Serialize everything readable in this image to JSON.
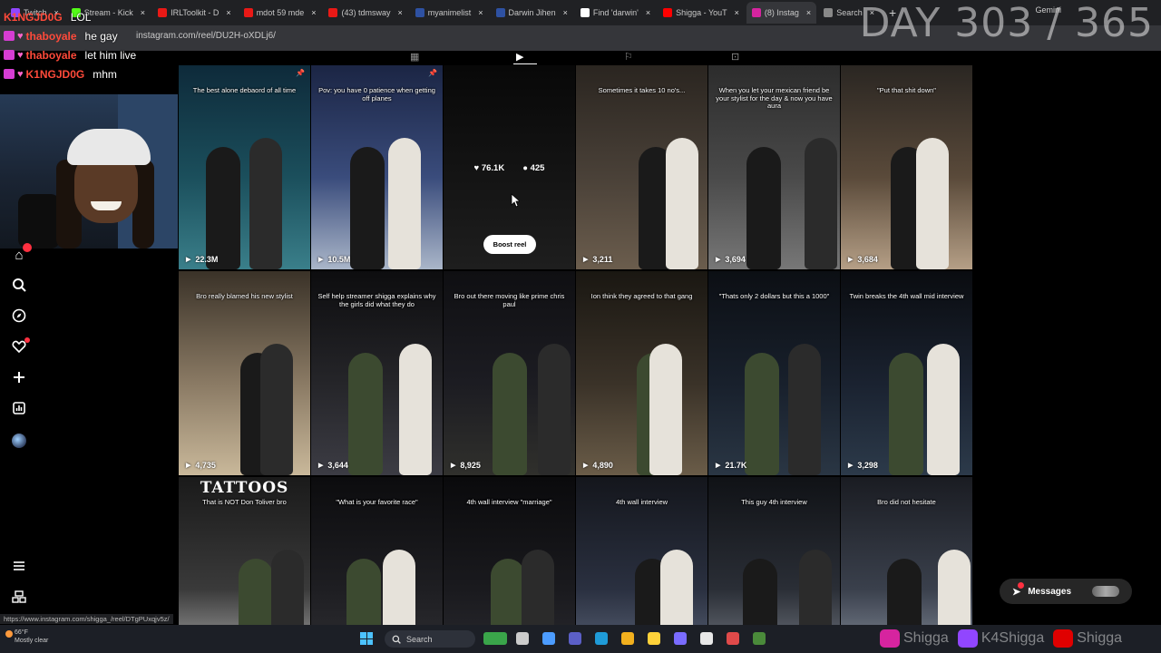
{
  "browser": {
    "tabs": [
      {
        "label": "Twitch",
        "color": "#9146ff"
      },
      {
        "label": "Stream - Kick",
        "color": "#53fc18"
      },
      {
        "label": "IRLToolkit - D",
        "color": "#e91916"
      },
      {
        "label": "mdot 59 mde",
        "color": "#e91916"
      },
      {
        "label": "(43) tdmsway",
        "color": "#e91916"
      },
      {
        "label": "myanimelist",
        "color": "#2e51a2"
      },
      {
        "label": "Darwin Jihen",
        "color": "#2e51a2"
      },
      {
        "label": "Find 'darwin'",
        "color": "#ffffff"
      },
      {
        "label": "Shigga - YouT",
        "color": "#ff0000"
      },
      {
        "label": "(8) Instag",
        "color": "#d6249f"
      },
      {
        "label": "Search",
        "color": "#888888"
      }
    ],
    "gemini_label": "Gemini",
    "url": "instagram.com/reel/DU2H-oXDLj6/",
    "day_counter": "DAY 303 / 365",
    "status_url": "https://www.instagram.com/shigga_/reel/DTgPUxqjv5z/"
  },
  "chat": [
    {
      "user": "K1NGJD0G",
      "message": "LOL",
      "color": "#ff4a3a"
    },
    {
      "user": "thaboyale",
      "message": "he gay",
      "color": "#ff4a3a"
    },
    {
      "user": "thaboyale",
      "message": "let him live",
      "color": "#ff4a3a"
    },
    {
      "user": "K1NGJD0G",
      "message": "mhm",
      "color": "#ff4a3a"
    }
  ],
  "hover_reel": {
    "likes": "76.1K",
    "comments": "425",
    "boost_label": "Boost reel"
  },
  "reels": [
    {
      "caption": "The best alone debaord of all time",
      "views": "22.3M"
    },
    {
      "caption": "Pov: you have 0 patience when getting off planes",
      "views": "10.5M"
    },
    {
      "caption": "",
      "views": ""
    },
    {
      "caption": "Sometimes it takes 10 no's...",
      "views": "3,211"
    },
    {
      "caption": "When you let your mexican friend be your stylist for the day & now you have aura",
      "views": "3,694"
    },
    {
      "caption": "\"Put that shit down\"",
      "views": "3,684"
    },
    {
      "caption": "Bro really blamed his new stylist",
      "views": "4,735"
    },
    {
      "caption": "Self help streamer shigga explains why the girls did what they do",
      "views": "3,644"
    },
    {
      "caption": "Bro out there moving like prime chris paul",
      "views": "8,925"
    },
    {
      "caption": "Ion think they agreed to that gang",
      "views": "4,890"
    },
    {
      "caption": "\"Thats only 2 dollars but this a 1000\"",
      "views": "21.7K"
    },
    {
      "caption": "Twin breaks the 4th wall mid interview",
      "views": "3,298"
    },
    {
      "caption": "That is NOT Don Toliver bro",
      "views": "",
      "title": "TATTOOS"
    },
    {
      "caption": "\"What is your favorite race\"",
      "views": ""
    },
    {
      "caption": "4th wall interview \"marriage\"",
      "views": ""
    },
    {
      "caption": "4th wall interview",
      "views": ""
    },
    {
      "caption": "This guy 4th interview",
      "views": ""
    },
    {
      "caption": "Bro did not hesitate",
      "views": ""
    }
  ],
  "messages_label": "Messages",
  "taskbar": {
    "weather_temp": "66°F",
    "weather_desc": "Mostly clear",
    "search_label": "Search"
  },
  "socials": [
    {
      "name": "Shigga",
      "icon": "instagram-icon",
      "color": "#d6249f"
    },
    {
      "name": "K4Shigga",
      "icon": "twitch-icon",
      "color": "#9146ff"
    },
    {
      "name": "Shigga",
      "icon": "youtube-icon",
      "color": "#e00000"
    }
  ]
}
